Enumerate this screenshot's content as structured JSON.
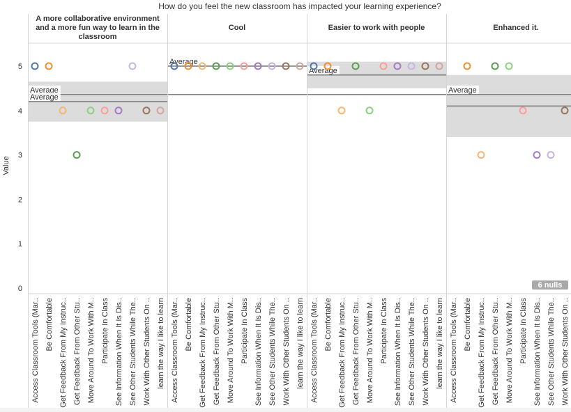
{
  "chart_data": {
    "type": "scatter",
    "title": "How do you feel the new classroom has impacted your learning experience?",
    "ylabel": "Value",
    "ylim": [
      0,
      5
    ],
    "yticks": [
      0,
      1,
      2,
      3,
      4,
      5
    ],
    "null_badge": "6 nulls",
    "average_label": "Average",
    "categories": [
      "Access Classroom Tools (Mar..",
      "Be Comfortable",
      "Get Feedback From My Instruc..",
      "Get Feedback From Other Stu..",
      "Move Around To Work With M..",
      "Participate In Class",
      "See Information When It Is Dis..",
      "See Other Students While The..",
      "Work With Other Students On ..",
      "learn the way I like to learn"
    ],
    "category_colors": [
      "#4e79a7",
      "#f28e2b",
      "#f4b870",
      "#59a14f",
      "#8cd17d",
      "#ff9d9a",
      "#a07cc5",
      "#c9b3e0",
      "#9c755f",
      "#d4a6a0"
    ],
    "facets": [
      {
        "label": "A more collaborative environment and a more fun way to learn in the classroom",
        "points": [
          {
            "cat": 0,
            "y": 5
          },
          {
            "cat": 1,
            "y": 5
          },
          {
            "cat": 2,
            "y": 4
          },
          {
            "cat": 3,
            "y": 3
          },
          {
            "cat": 4,
            "y": 4
          },
          {
            "cat": 5,
            "y": 4
          },
          {
            "cat": 6,
            "y": 4
          },
          {
            "cat": 7,
            "y": 5
          },
          {
            "cat": 8,
            "y": 4
          },
          {
            "cat": 9,
            "y": 4
          }
        ],
        "averages": [
          4.36,
          4.2
        ],
        "band": [
          3.75,
          4.65
        ]
      },
      {
        "label": "Cool",
        "points": [
          {
            "cat": 0,
            "y": 5
          },
          {
            "cat": 1,
            "y": 5
          },
          {
            "cat": 2,
            "y": 5
          },
          {
            "cat": 3,
            "y": 5
          },
          {
            "cat": 4,
            "y": 5
          },
          {
            "cat": 5,
            "y": 5
          },
          {
            "cat": 6,
            "y": 5
          },
          {
            "cat": 7,
            "y": 5
          },
          {
            "cat": 8,
            "y": 5
          },
          {
            "cat": 9,
            "y": 5
          }
        ],
        "averages": [
          5.0,
          4.36
        ],
        "band": [
          5.0,
          5.0
        ]
      },
      {
        "label": "Easier to work with people",
        "points": [
          {
            "cat": 0,
            "y": 5
          },
          {
            "cat": 1,
            "y": 5
          },
          {
            "cat": 2,
            "y": 4
          },
          {
            "cat": 3,
            "y": 5
          },
          {
            "cat": 4,
            "y": 4
          },
          {
            "cat": 5,
            "y": 5
          },
          {
            "cat": 6,
            "y": 5
          },
          {
            "cat": 7,
            "y": 5
          },
          {
            "cat": 8,
            "y": 5
          },
          {
            "cat": 9,
            "y": 5
          }
        ],
        "averages": [
          4.8,
          4.36
        ],
        "band": [
          4.5,
          5.1
        ]
      },
      {
        "label": "Enhanced it.",
        "points": [
          {
            "cat": 1,
            "y": 5
          },
          {
            "cat": 2,
            "y": 3
          },
          {
            "cat": 3,
            "y": 5
          },
          {
            "cat": 4,
            "y": 5
          },
          {
            "cat": 5,
            "y": 4
          },
          {
            "cat": 6,
            "y": 3
          },
          {
            "cat": 7,
            "y": 3
          },
          {
            "cat": 8,
            "y": 4
          }
        ],
        "averages": [
          4.36,
          4.1
        ],
        "band": [
          3.4,
          4.8
        ]
      }
    ]
  }
}
